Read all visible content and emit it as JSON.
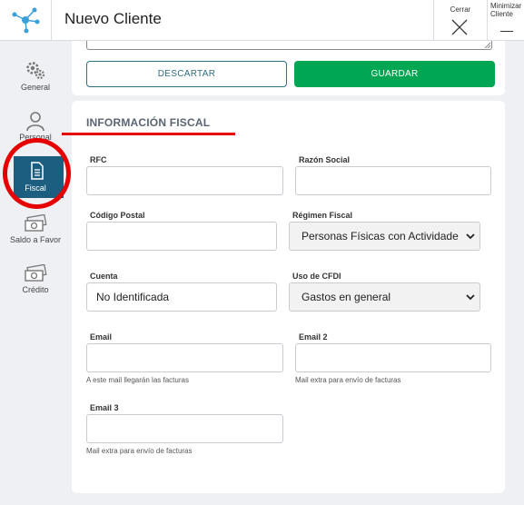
{
  "header": {
    "title": "Nuevo Cliente",
    "close_label": "Cerrar",
    "minimize_label": "Minimizar Cliente"
  },
  "sidebar": {
    "items": [
      {
        "label": "General",
        "icon": "gears-icon"
      },
      {
        "label": "Personal",
        "icon": "person-icon"
      },
      {
        "label": "Fiscal",
        "icon": "document-icon",
        "active": true
      },
      {
        "label": "Saldo a Favor",
        "icon": "cash-icon"
      },
      {
        "label": "Crédito",
        "icon": "cash-icon"
      }
    ]
  },
  "actions": {
    "discard_label": "DESCARTAR",
    "save_label": "GUARDAR"
  },
  "fiscal": {
    "section_title": "INFORMACIÓN FISCAL",
    "rfc": {
      "label": "RFC",
      "value": ""
    },
    "razon_social": {
      "label": "Razón Social",
      "value": ""
    },
    "codigo_postal": {
      "label": "Código Postal",
      "value": ""
    },
    "regimen_fiscal": {
      "label": "Régimen Fiscal",
      "value": "Personas Físicas con Actividade"
    },
    "cuenta": {
      "label": "Cuenta",
      "value": "No Identificada"
    },
    "uso_cfdi": {
      "label": "Uso de CFDI",
      "value": "Gastos en general"
    },
    "email": {
      "label": "Email",
      "value": "",
      "hint": "A este mail llegarán las facturas"
    },
    "email2": {
      "label": "Email 2",
      "value": "",
      "hint": "Mail extra para envío de facturas"
    },
    "email3": {
      "label": "Email 3",
      "value": "",
      "hint": "Mail extra para envío de facturas"
    }
  },
  "colors": {
    "accent": "#1b5e80",
    "save": "#00a651",
    "annotation": "#e60000"
  }
}
